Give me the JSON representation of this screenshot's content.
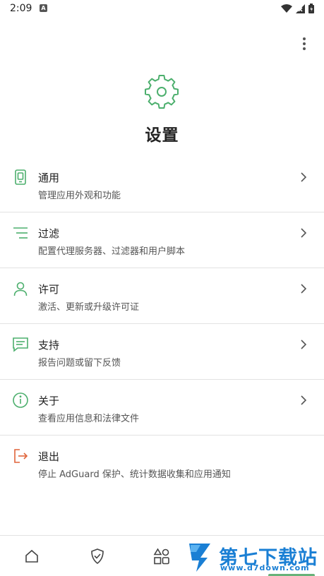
{
  "status_bar": {
    "time": "2:09",
    "notification_badge": "A"
  },
  "header": {
    "title": "设置",
    "icon": "gear-icon"
  },
  "settings": [
    {
      "icon": "phone-icon",
      "title": "通用",
      "description": "管理应用外观和功能",
      "color": "#4caf6d"
    },
    {
      "icon": "filter-lines-icon",
      "title": "过滤",
      "description": "配置代理服务器、过滤器和用户脚本",
      "color": "#4caf6d"
    },
    {
      "icon": "person-icon",
      "title": "许可",
      "description": "激活、更新或升级许可证",
      "color": "#4caf6d"
    },
    {
      "icon": "chat-icon",
      "title": "支持",
      "description": "报告问题或留下反馈",
      "color": "#4caf6d"
    },
    {
      "icon": "info-icon",
      "title": "关于",
      "description": "查看应用信息和法律文件",
      "color": "#4caf6d"
    },
    {
      "icon": "logout-icon",
      "title": "退出",
      "description": "停止 AdGuard 保护、统计数据收集和应用通知",
      "color": "#e0643a"
    }
  ],
  "bottom_nav": {
    "items": [
      "home-icon",
      "shield-icon",
      "apps-icon",
      "settings-icon"
    ],
    "active_index": 3,
    "accent": "#67b279"
  },
  "watermark": {
    "name": "第七下载站",
    "url": "www.d7down.com"
  }
}
